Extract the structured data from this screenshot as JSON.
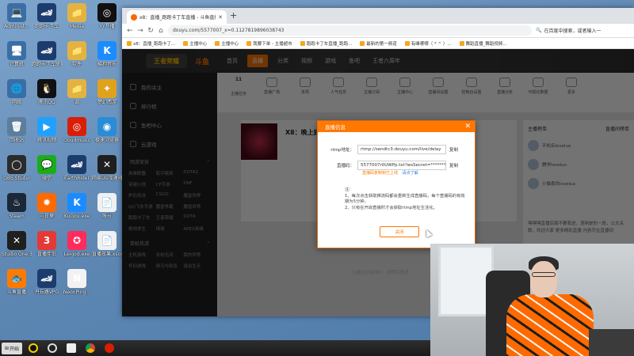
{
  "desktop": {
    "icons": [
      {
        "label": "Administ...",
        "glyph": "💻",
        "color": "#3a6ea5"
      },
      {
        "label": "跑跑卡丁车",
        "glyph": "🏎",
        "color": "#1d3c6e"
      },
      {
        "label": "Media",
        "glyph": "📁",
        "color": "#e3b341"
      },
      {
        "label": "YY开播",
        "glyph": "◎",
        "color": "#111111"
      },
      {
        "label": "计算机",
        "glyph": "🖥",
        "color": "#3a6ea5"
      },
      {
        "label": "跑跑卡丁车联赛版",
        "glyph": "🏎",
        "color": "#1d3c6e"
      },
      {
        "label": "软件",
        "glyph": "📁",
        "color": "#e3b341"
      },
      {
        "label": "酷狗音乐",
        "glyph": "K",
        "color": "#1a8cff"
      },
      {
        "label": "网络",
        "glyph": "🌐",
        "color": "#3a6ea5"
      },
      {
        "label": "腾讯QQ",
        "glyph": "🐧",
        "color": "#111111"
      },
      {
        "label": "调",
        "glyph": "📁",
        "color": "#e3b341"
      },
      {
        "label": "梦幻西游",
        "glyph": "✦",
        "color": "#e1a21b"
      },
      {
        "label": "回收站",
        "glyph": "🗑",
        "color": "#5d7d9c"
      },
      {
        "label": "腾讯视频",
        "glyph": "▶",
        "color": "#20a0ff"
      },
      {
        "label": "cloudmusic",
        "glyph": "◎",
        "color": "#d81e06"
      },
      {
        "label": "极速浏览器",
        "glyph": "◉",
        "color": "#2a8cd6"
      },
      {
        "label": "OBS Studio",
        "glyph": "◯",
        "color": "#2b2b2b"
      },
      {
        "label": "微信",
        "glyph": "💬",
        "color": "#1aad19"
      },
      {
        "label": "EarthRider",
        "glyph": "🏎",
        "color": "#1d3c6e"
      },
      {
        "label": "网易UU加速器",
        "glyph": "✕",
        "color": "#1f1f1f"
      },
      {
        "label": "Steam",
        "glyph": "♨",
        "color": "#1b2838"
      },
      {
        "label": "向日葵",
        "glyph": "✹",
        "color": "#ff6a00"
      },
      {
        "label": "KuGou.exe",
        "glyph": "K",
        "color": "#1a8cff"
      },
      {
        "label": "账号",
        "glyph": "📄",
        "color": "#f0f0f0"
      },
      {
        "label": "Studio One 3",
        "glyph": "✕",
        "color": "#1f1f1f"
      },
      {
        "label": "直播伴侣",
        "glyph": "3",
        "color": "#e53935"
      },
      {
        "label": "Leigod.exe",
        "glyph": "✪",
        "color": "#ff2b5a"
      },
      {
        "label": "直播效果.xsong",
        "glyph": "📄",
        "color": "#f0f0f0"
      },
      {
        "label": "斗鱼直播",
        "glyph": "🐟",
        "color": "#ff7a00"
      },
      {
        "label": "丹丘路VPG",
        "glyph": "🏎",
        "color": "#1d3c6e"
      },
      {
        "label": "NeonPing...",
        "glyph": "N",
        "color": "#f2f2f2"
      }
    ]
  },
  "browser": {
    "tab_title": "x8：直播_跑跑卡丁车直播 - 斗鱼直播",
    "url": "douyu.com/5577007_x=0.1127819896038743",
    "search_placeholder": "在百度中搜索，或者输入一",
    "bookmarks": [
      "x8：直播_跑跑卡丁...",
      "主播中心",
      "主播中心",
      "我要下单 - 主播超市",
      "跑跑卡丁车直播_跑跑...",
      "最新的第一频道",
      "有峰哪哪（ * ^ ）...",
      "舞蹈直播_舞蹈视频..."
    ]
  },
  "site": {
    "logo_text": "王者荣耀",
    "brand": "斗鱼",
    "nav": [
      "首页",
      "直播",
      "分类",
      "视频",
      "游戏",
      "鱼吧",
      "王者六周年"
    ],
    "active_nav": "直播",
    "sidebar_items": [
      "我的关注",
      "排行榜",
      "鱼吧中心",
      "云游戏"
    ],
    "sidebar_section1": "网游竞技",
    "sidebar_grid1": [
      "英雄联盟",
      "和平精英",
      "DOTA2",
      "穿越火线",
      "CF手游",
      "DNF",
      "炉石传说",
      "CSGO",
      "魔兽世界",
      "QQ飞车手游",
      "魔兽争霸",
      "魔兽世界",
      "跑跑卡丁车",
      "王者荣耀",
      "DOTA",
      "绝地求生",
      "球球",
      "APEX英雄"
    ],
    "sidebar_section2": "单机热游",
    "sidebar_grid2": [
      "主机游戏",
      "永劫无间",
      "我的世界",
      "怀旧游戏",
      "骑马与砍杀",
      "逃出生天"
    ],
    "categories": [
      "主播任务",
      "直播广场",
      "本周",
      "人气任务",
      "主播订阅",
      "主播中心",
      "直播间设置",
      "控制台设置",
      "直播分析",
      "可视化数据",
      "更多"
    ],
    "first_cat_top": "11",
    "room_title": "X8：晚上好",
    "chat_header": "主播榜单",
    "chat_tab": "直播间榜单",
    "chat_users": [
      "不知名loveluo",
      "腾学loveluo",
      "小猫喜欢lovelua"
    ],
    "chat_text": "嘿嘿嘿直播后面不要我进，混响是的一段，公文关联，欢迎大家 更多精彩直播 内容尽在直播间",
    "footnote": "主播正在连线中，请稍后重试"
  },
  "modal": {
    "title": "直播信息",
    "rtmp_label": "rtmp地址：",
    "rtmp_value": "rtmp://sendtc3.douyu.com/live/delay",
    "code_label": "直播码：",
    "code_value": "5577007r0UWPp.txt?wsSecret=********",
    "copy_label": "复制",
    "warn_text": "直播码复制到已上线",
    "learn_link": "请点了解",
    "notes_title": "注：",
    "note1": "1、每次点击获取推流码都会重新生成直播码，每个直播码的有效期为5分钟。",
    "note2": "2、只有在开启直播时才会获取rtmp地址生活化。",
    "close_button": "关闭"
  },
  "taskbar": {
    "start_label": "开始",
    "apps": [
      "YY开播",
      "OBS",
      "Studio One",
      "Chrome",
      "网易云音乐"
    ]
  }
}
